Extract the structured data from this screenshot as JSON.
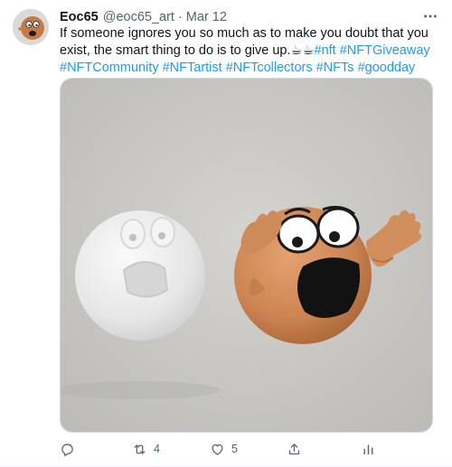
{
  "tweet": {
    "author": {
      "display_name": "Eoc65",
      "handle": "@eoc65_art",
      "separator": "·",
      "date": "Mar 12"
    },
    "text": "If someone ignores you so much as to make you doubt that you exist, the smart thing to do is to give up.",
    "emoji": "☕☕",
    "hashtags": [
      "#nft",
      "#NFTGiveaway",
      "#NFTCommunity",
      "#NFTartist",
      "#NFTcollectors",
      "#NFTs",
      "#goodday"
    ],
    "media": {
      "background_color": "#c9c8c5",
      "white_face_color": "#e9e9e9",
      "orange_face_color": "#cf8a5a"
    },
    "actions": {
      "reply_icon": "reply-icon",
      "retweet_icon": "retweet-icon",
      "retweet_count": "4",
      "like_icon": "heart-icon",
      "like_count": "5",
      "share_icon": "share-icon",
      "analytics_icon": "analytics-icon"
    },
    "colors": {
      "link": "#1d9bf0",
      "secondary_text": "#536471"
    }
  }
}
